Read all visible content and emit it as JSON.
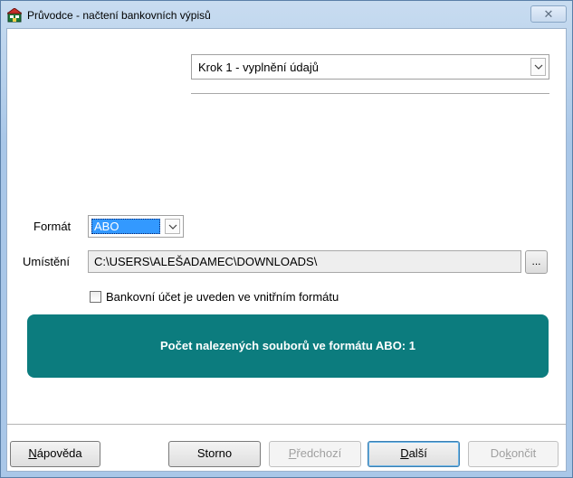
{
  "window": {
    "title": "Průvodce - načtení bankovních výpisů",
    "close_glyph": "✕"
  },
  "step": {
    "selected": "Krok 1 - vyplnění údajů"
  },
  "form": {
    "format_label": "Formát",
    "format_value": "ABO",
    "location_label": "Umístění",
    "location_value": "C:\\USERS\\ALEŠADAMEC\\DOWNLOADS\\",
    "browse_label": "...",
    "checkbox_label": "Bankovní účet je uveden ve vnitřním formátu",
    "checkbox_checked": false
  },
  "banner": {
    "text": "Počet nalezených souborů ve formátu ABO: 1"
  },
  "buttons": {
    "help": {
      "pre": "",
      "u": "N",
      "post": "ápověda"
    },
    "cancel": {
      "pre": "Storno",
      "u": "",
      "post": ""
    },
    "prev": {
      "pre": "",
      "u": "P",
      "post": "ředchozí"
    },
    "next": {
      "pre": "",
      "u": "D",
      "post": "alší"
    },
    "finish": {
      "pre": "Do",
      "u": "k",
      "post": "ončit"
    }
  },
  "colors": {
    "banner": "#0c7c7e",
    "selection": "#3399ff"
  },
  "icons": {
    "app": "app-icon",
    "dropdown": "chevron-down-icon"
  }
}
